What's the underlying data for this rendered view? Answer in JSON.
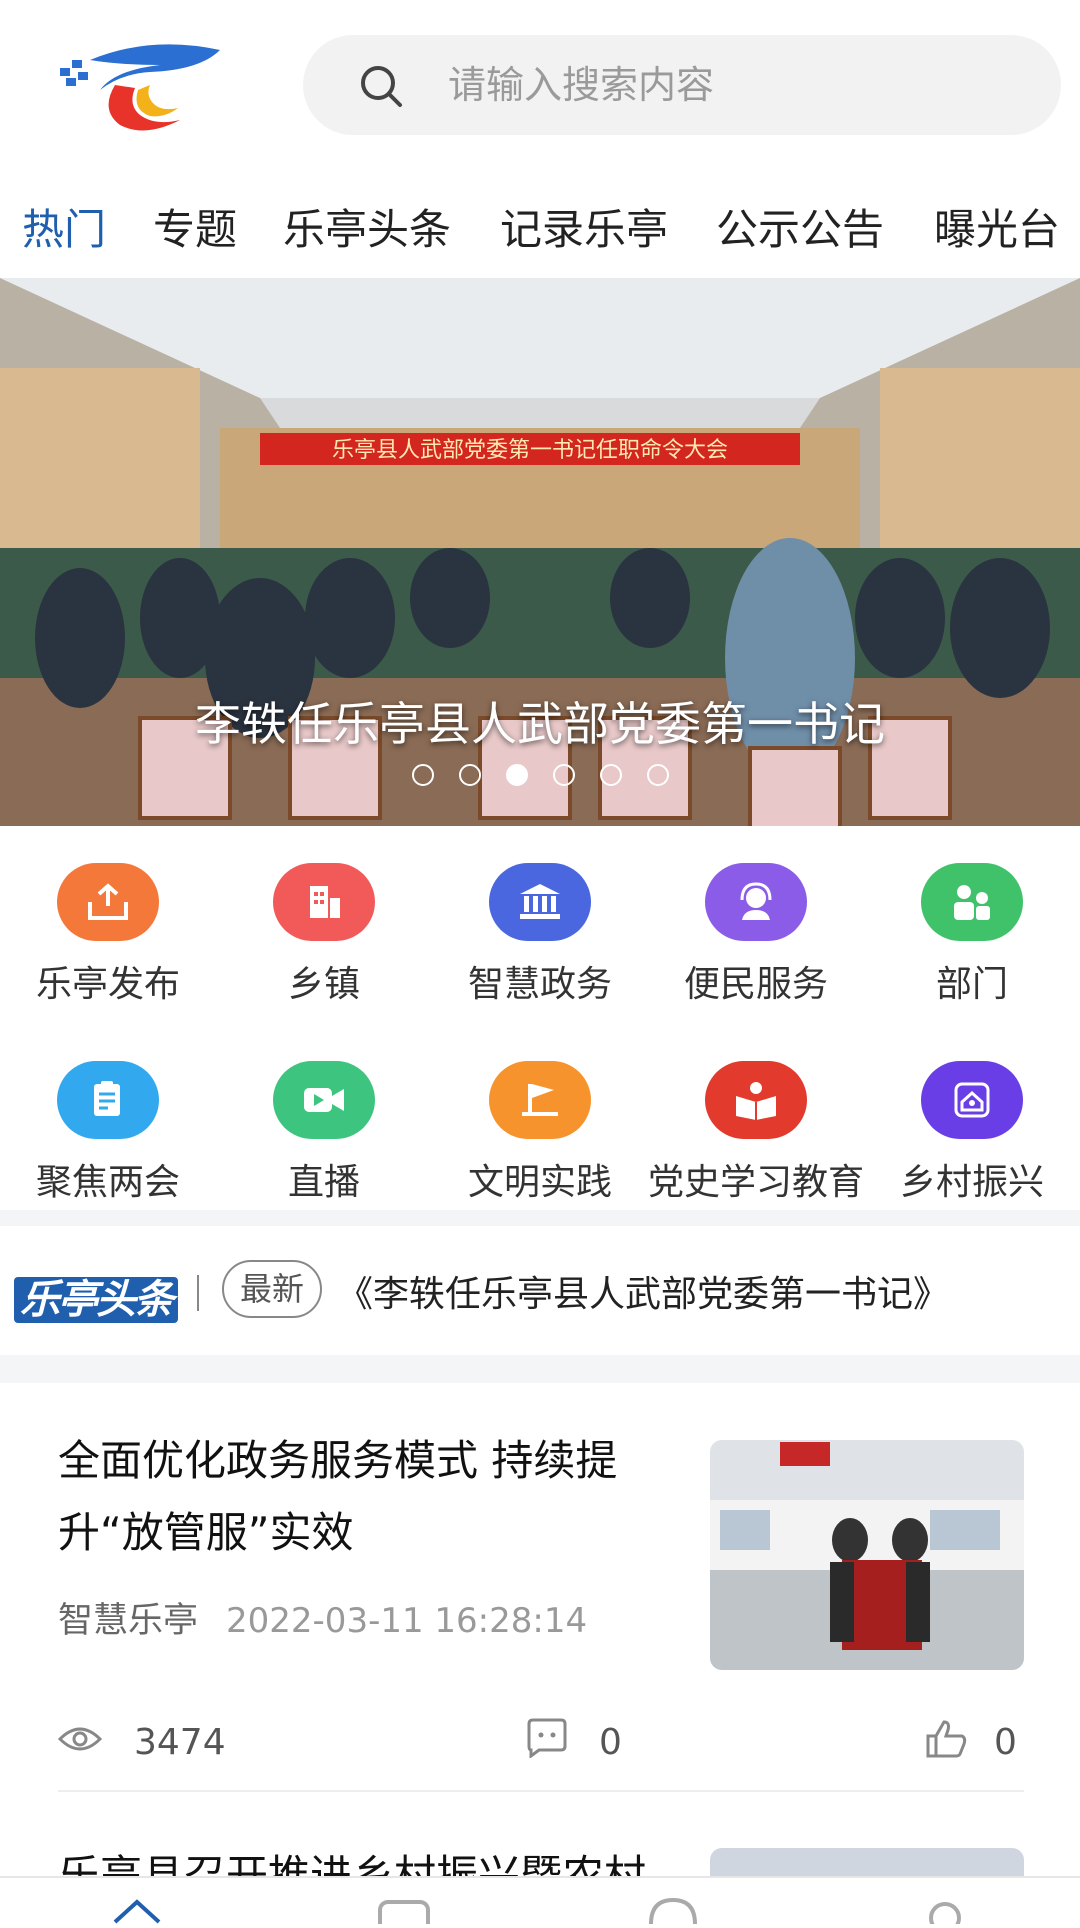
{
  "search": {
    "placeholder": "请输入搜索内容"
  },
  "tabs": [
    {
      "label": "热门",
      "active": true
    },
    {
      "label": "专题",
      "active": false
    },
    {
      "label": "乐亭头条",
      "active": false
    },
    {
      "label": "记录乐亭",
      "active": false
    },
    {
      "label": "公示公告",
      "active": false
    },
    {
      "label": "曝光台",
      "active": false
    }
  ],
  "banner": {
    "title": "李轶任乐亭县人武部党委第一书记",
    "stage_sign": "乐亭县人武部党委第一书记任职命令大会",
    "dots_total": 6,
    "dots_active": 3
  },
  "grid": [
    {
      "label": "乐亭发布",
      "icon": "upload-icon",
      "color": "#f4783a"
    },
    {
      "label": "乡镇",
      "icon": "building-icon",
      "color": "#f25a5a"
    },
    {
      "label": "智慧政务",
      "icon": "government-icon",
      "color": "#4a67e0"
    },
    {
      "label": "便民服务",
      "icon": "customer-service-icon",
      "color": "#8a5ce8"
    },
    {
      "label": "部门",
      "icon": "people-icon",
      "color": "#3fc26a"
    },
    {
      "label": "聚焦两会",
      "icon": "clipboard-icon",
      "color": "#32a8ee"
    },
    {
      "label": "直播",
      "icon": "video-camera-icon",
      "color": "#3dc47f"
    },
    {
      "label": "文明实践",
      "icon": "flag-icon",
      "color": "#f7932c"
    },
    {
      "label": "党史学习教育",
      "icon": "reading-icon",
      "color": "#e23a2c"
    },
    {
      "label": "乡村振兴",
      "icon": "home-icon",
      "color": "#6a3ee6"
    }
  ],
  "headline": {
    "logo_text": "乐亭头条",
    "badge": "最新",
    "text": "《李轶任乐亭县人武部党委第一书记》"
  },
  "news": [
    {
      "title": "全面优化政务服务模式 持续提升“放管服”实效",
      "source": "智慧乐亭",
      "time": "2022-03-11 16:28:14",
      "views": "3474",
      "comments": "0",
      "likes": "0"
    },
    {
      "title": "乐亭县召开推进乡村振兴暨农村"
    }
  ],
  "colors": {
    "accent": "#1f5fae"
  }
}
